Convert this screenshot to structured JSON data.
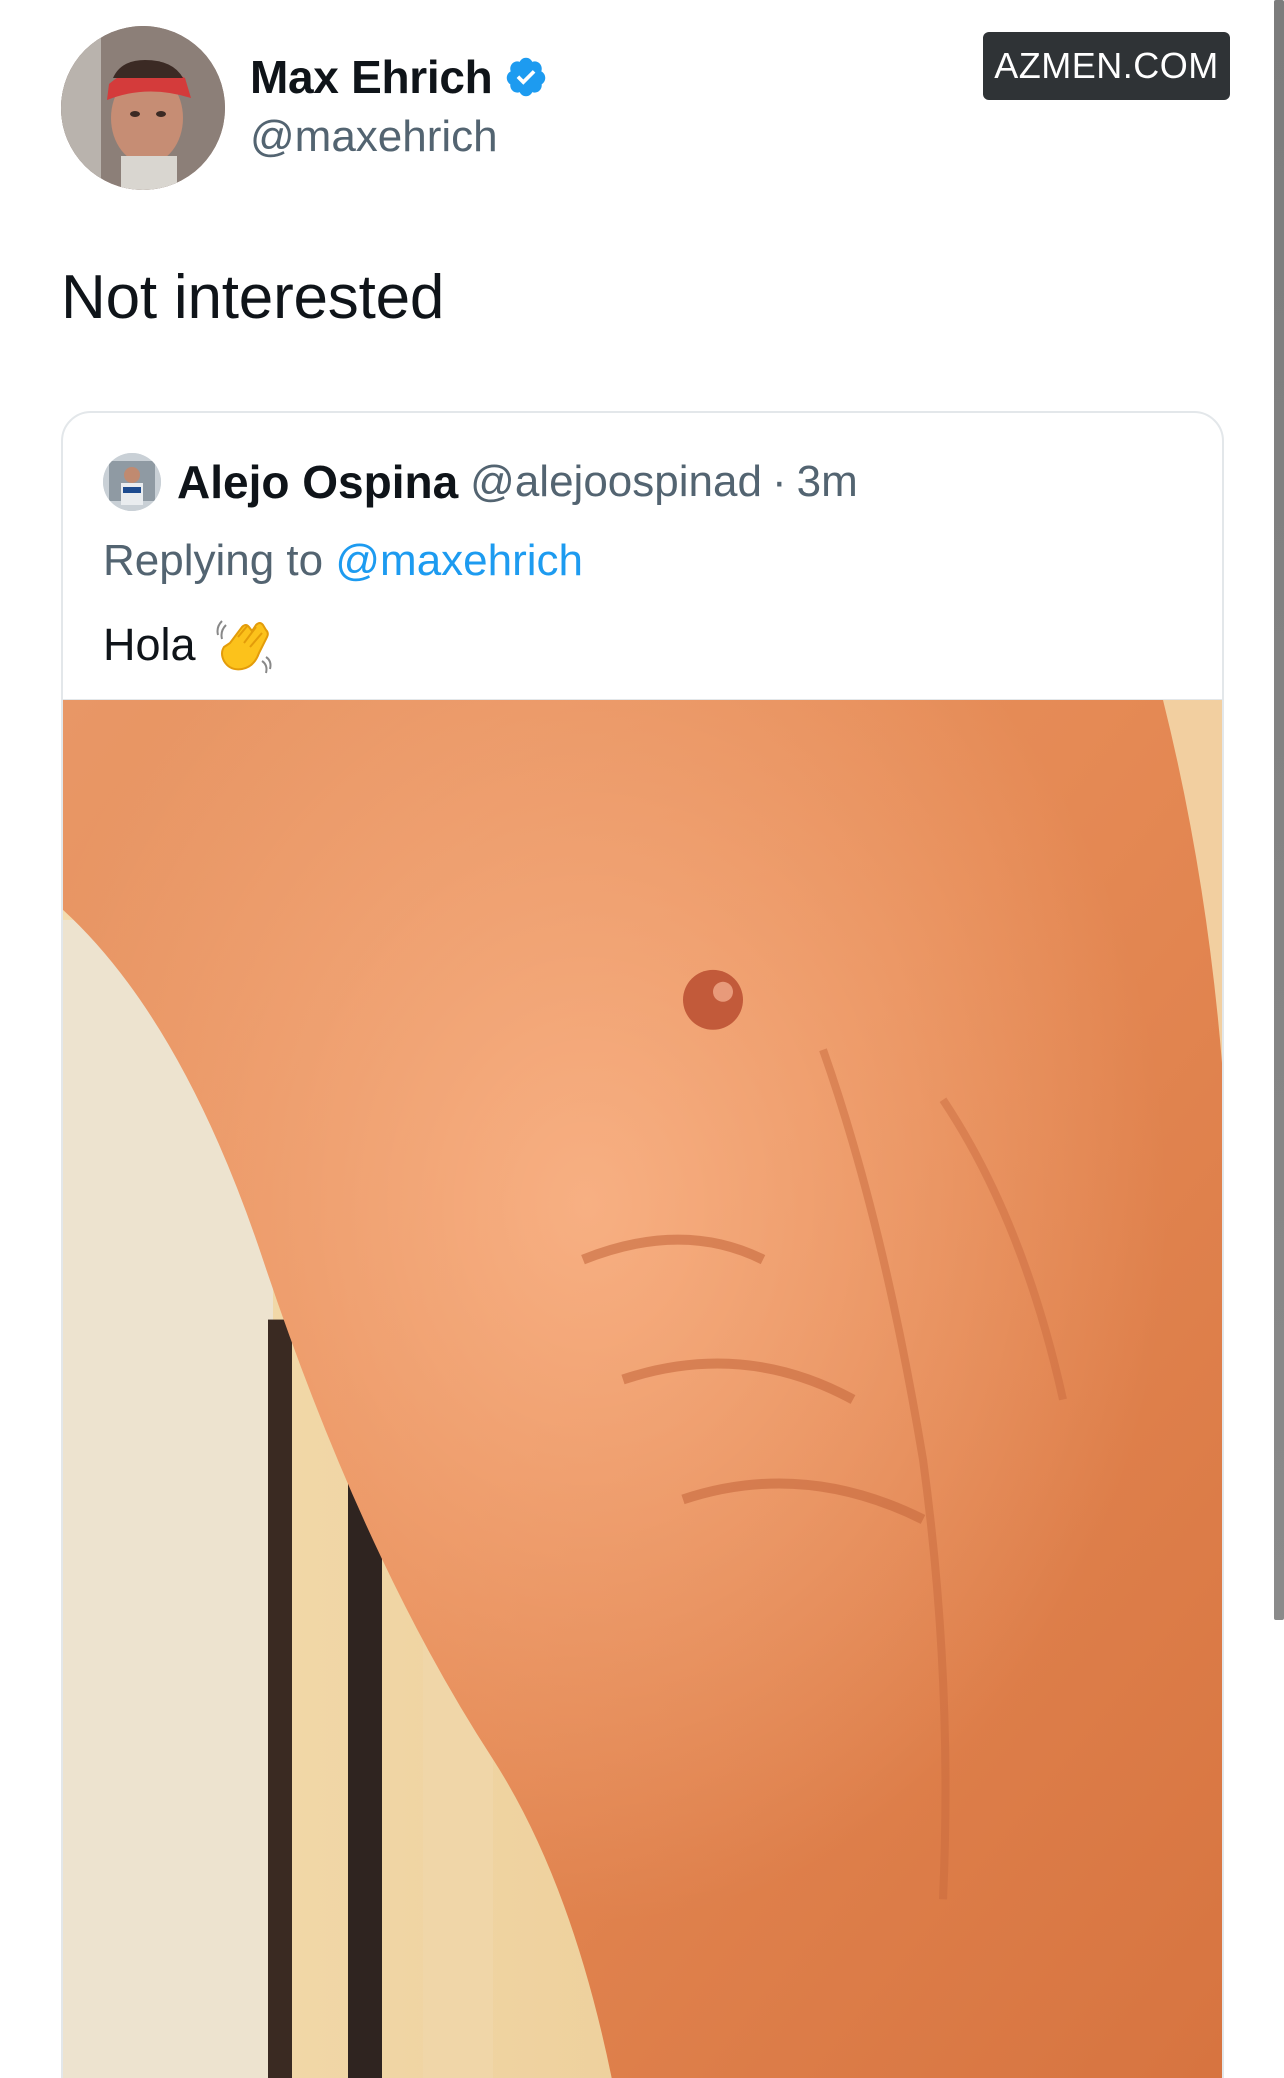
{
  "author": {
    "display_name": "Max Ehrich",
    "handle": "@maxehrich",
    "verified": true,
    "avatar_icon": "profile-photo-red-cap"
  },
  "watermark": "AZMEN.COM",
  "tweet": {
    "text": "Not interested"
  },
  "quoted_tweet": {
    "display_name": "Alejo Ospina",
    "handle": "@alejoospinad",
    "separator": "·",
    "time": "3m",
    "reply_prefix": "Replying to",
    "reply_mention": "@maxehrich",
    "text": "Hola",
    "emoji_icon": "waving-hand-icon",
    "media_icon": "photo-torso"
  },
  "colors": {
    "mention": "#1d9bf0",
    "secondary_text": "#536471",
    "verified_badge": "#1d9bf0",
    "watermark_bg": "#2f3336"
  }
}
